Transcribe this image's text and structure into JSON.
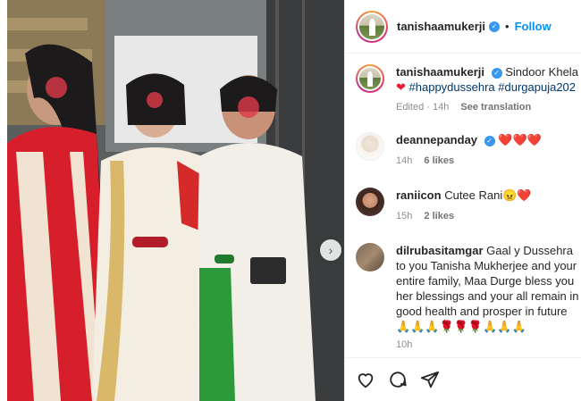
{
  "post": {
    "username": "tanishaamukerji",
    "follow_label": "Follow",
    "separator": "•",
    "caption_text": "Sindoor Khela",
    "caption_hashtags": "#happydussehra #durgapuja202",
    "caption_meta_time": "Edited · 14h",
    "see_translation": "See translation"
  },
  "comments": [
    {
      "username": "deannepanday",
      "text": "❤️❤️❤️",
      "time": "14h",
      "likes": "6 likes"
    },
    {
      "username": "raniicon",
      "text": "Cutee Rani😠❤️",
      "time": "15h",
      "likes": "2 likes"
    },
    {
      "username": "dilrubasitamgar",
      "text": "Gaal y Dussehra to you Tanisha Mukherjee and your entire family, Maa Durge bless you her blessings and your all remain in good health and prosper in future",
      "emojis": "🙏🙏🙏🌹🌹🌹🙏🙏🙏",
      "time": "10h"
    }
  ],
  "icons": {
    "verified": "verified-badge-icon",
    "like": "heart-icon",
    "comment": "comment-icon",
    "share": "share-icon",
    "next": "chevron-right-icon"
  },
  "colors": {
    "accent": "#0095f6",
    "verified": "#3897f0",
    "hashtag": "#00376b",
    "heart": "#ed1c3a"
  }
}
